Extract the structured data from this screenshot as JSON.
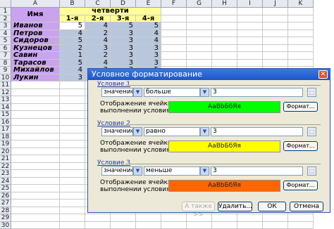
{
  "sheet": {
    "columns": [
      "A",
      "B",
      "C",
      "D",
      "E",
      "F",
      "G",
      "H",
      "I",
      "J",
      "K"
    ],
    "rows": [
      "1",
      "2",
      "3",
      "4",
      "5",
      "6",
      "7",
      "8",
      "9",
      "10",
      "11",
      "12",
      "13",
      "14",
      "15",
      "16",
      "17",
      "18",
      "19",
      "20",
      "21",
      "22",
      "23",
      "24",
      "25",
      "26",
      "27",
      "28",
      "29",
      "30"
    ],
    "header_name": "Имя",
    "header_quarters": "четверти",
    "quarter_labels": [
      "1-я",
      "2-я",
      "3-я",
      "4-я"
    ],
    "names": [
      "Иванов",
      "Петров",
      "Сидоров",
      "Кузнецов",
      "Савин",
      "Тарасов",
      "Михайлов",
      "Лукин"
    ],
    "values": [
      [
        "5",
        "4",
        "5",
        "5"
      ],
      [
        "4",
        "2",
        "3",
        "4"
      ],
      [
        "5",
        "4",
        "3",
        "4"
      ],
      [
        "2",
        "3",
        "3",
        "3"
      ],
      [
        "1",
        "2",
        "3",
        "3"
      ],
      [
        "5",
        "4",
        "3",
        "3"
      ],
      [
        "4",
        "3",
        "3",
        "5"
      ],
      [
        "3",
        "2",
        "3",
        "4"
      ]
    ]
  },
  "dialog": {
    "title": "Условное форматирование",
    "close_glyph": "✕",
    "conditions": [
      {
        "title": "Условие 1",
        "type": "значение",
        "operator": "больше",
        "value": "3",
        "desc_line1": "Отображение ячейки при",
        "desc_line2": "выполнении условия:",
        "preview": "АаВbБбЯя",
        "preview_color": "#00ff00",
        "format_label": "Формат..."
      },
      {
        "title": "Условие 2",
        "type": "значение",
        "operator": "равно",
        "value": "3",
        "desc_line1": "Отображение ячейки при",
        "desc_line2": "выполнении условия:",
        "preview": "АаВbБбЯя",
        "preview_color": "#ffff00",
        "format_label": "Формат..."
      },
      {
        "title": "Условие 3",
        "type": "значение",
        "operator": "меньше",
        "value": "3",
        "desc_line1": "Отображение ячейки при",
        "desc_line2": "выполнении условия:",
        "preview": "АаВbБбЯя",
        "preview_color": "#ff6600",
        "format_label": "Формат..."
      }
    ],
    "buttons": {
      "also": "А также >>",
      "delete": "Удалить...",
      "ok": "ОК",
      "cancel": "Отмена"
    },
    "icons": {
      "dropdown": "dropdown-arrow-icon",
      "pick": "range-select-icon"
    },
    "dropdown_glyph": "▼",
    "pick_glyph": "⬚"
  }
}
